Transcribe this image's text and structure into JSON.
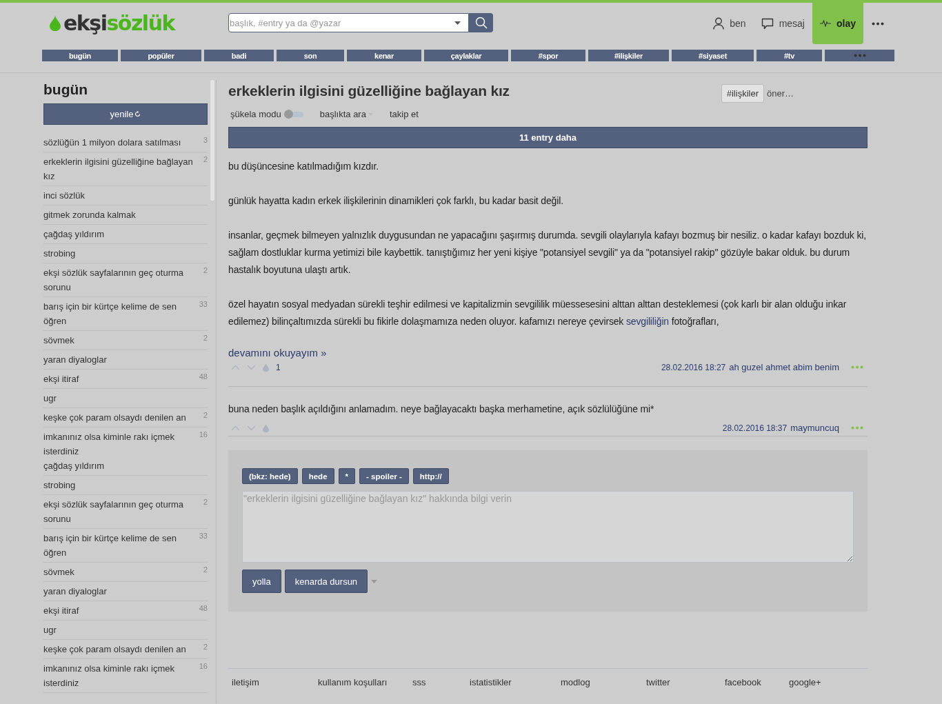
{
  "logo": {
    "first": "ekşi",
    "second": "sözlük"
  },
  "search": {
    "placeholder": "başlık, #entry ya da @yazar"
  },
  "user_menu": [
    {
      "kind": "user",
      "label": "ben",
      "selected": false
    },
    {
      "kind": "message",
      "label": "mesaj",
      "selected": false
    },
    {
      "kind": "pulse",
      "label": "olay",
      "selected": true
    }
  ],
  "nav_tabs": [
    "bugün",
    "popüler",
    "badi",
    "son",
    "kenar",
    "çaylaklar",
    "#spor",
    "#ilişkiler",
    "#siyaset",
    "#tv"
  ],
  "sidebar": {
    "title": "bugün",
    "refresh_button": "yenile",
    "items": [
      {
        "title": "sözlüğün 1 milyon dolara satılması",
        "count": "3"
      },
      {
        "title": "erkeklerin ilgisini güzelliğine bağlayan kız",
        "count": "2"
      },
      {
        "title": "inci sözlük"
      },
      {
        "title": "gitmek zorunda kalmak"
      },
      {
        "title": "çağdaş yıldırım"
      },
      {
        "title": "strobing"
      },
      {
        "title": "ekşi sözlük sayfalarının geç oturma sorunu",
        "count": "2"
      },
      {
        "title": "barış için bir kürtçe kelime de sen öğren",
        "count": "33"
      },
      {
        "title": "sövmek",
        "count": "2"
      },
      {
        "title": "yaran diyaloglar"
      },
      {
        "title": "ekşi itiraf",
        "count": "48"
      },
      {
        "title": "ugr"
      },
      {
        "title": "keşke çok param olsaydı denilen an",
        "count": "2"
      },
      {
        "title": "imkanınız olsa kiminle rakı içmek isterdiniz",
        "count": "16",
        "extra": "çağdaş yıldırım"
      },
      {
        "title": "strobing"
      },
      {
        "title": "ekşi sözlük sayfalarının geç oturma sorunu",
        "count": "2"
      },
      {
        "title": "barış için bir kürtçe kelime de sen öğren",
        "count": "33"
      },
      {
        "title": "sövmek",
        "count": "2"
      },
      {
        "title": "yaran diyaloglar"
      },
      {
        "title": "ekşi itiraf",
        "count": "48"
      },
      {
        "title": "ugr"
      },
      {
        "title": "keşke çok param olsaydı denilen an",
        "count": "2"
      },
      {
        "title": "imkanınız olsa kiminle rakı içmek isterdiniz",
        "count": "16"
      }
    ]
  },
  "topic": {
    "title": "erkeklerin ilgisini güzelliğine bağlayan kız",
    "channel_tag": "#ilişkiler",
    "suggest": "öner…",
    "toolbar": {
      "sukela_label": "şükela modu",
      "sukela_on": false,
      "search_in_topic": "başlıkta ara",
      "follow": "takip et"
    },
    "more_entries": "11 entry daha",
    "entries": [
      {
        "paragraphs": [
          {
            "text": "bu düşüncesine katılmadığım kızdır."
          },
          {
            "text": "günlük hayatta kadın erkek ilişkilerinin dinamikleri çok farklı, bu kadar basit değil."
          },
          {
            "text": "insanlar, geçmek bilmeyen yalnızlık duygusundan ne yapacağını şaşırmış durumda. sevgili olaylarıyla kafayı bozmuş bir nesiliz. o kadar kafayı bozduk ki, sağlam dostluklar kurma yetimizi bile kaybettik. tanıştığımız her yeni kişiye \"potansiyel sevgili\" ya da \"potansiyel rakip\" gözüyle bakar olduk. bu durum hastalık boyutuna ulaştı artık."
          },
          {
            "text": "özel hayatın sosyal medyadan sürekli teşhir edilmesi ve kapitalizmin sevgililik müessesesini alttan alttan desteklemesi (çok karlı bir alan olduğu inkar edilemez) bilinçaltımızda sürekli bu fikirle dolaşmamıza neden oluyor. kafamızı nereye çevirsek ",
            "link": "sevgililiğin",
            "after": " fotoğrafları,"
          }
        ],
        "read_more": "devamını okuyayım »",
        "favorites": "1",
        "date": "28.02.2016 18:27",
        "author": "ah guzel ahmet abim benim"
      },
      {
        "paragraphs": [
          {
            "text": "buna neden başlık açıldığını anlamadım. neye bağlayacaktı başka merhametine, açık sözlülüğüne mi*"
          }
        ],
        "date": "28.02.2016 18:37",
        "author": "maymuncuq"
      }
    ],
    "editor": {
      "format_buttons": [
        "(bkz: hede)",
        "hede",
        "*",
        "- spoiler -",
        "http://"
      ],
      "placeholder": "\"erkeklerin ilgisini güzelliğine bağlayan kız\" hakkında bilgi verin",
      "send": "yolla",
      "save": "kenarda dursun"
    }
  },
  "footer_links": [
    "iletişim",
    "kullanım koşulları",
    "sss",
    "istatistikler",
    "modlog",
    "twitter",
    "facebook",
    "google+"
  ]
}
